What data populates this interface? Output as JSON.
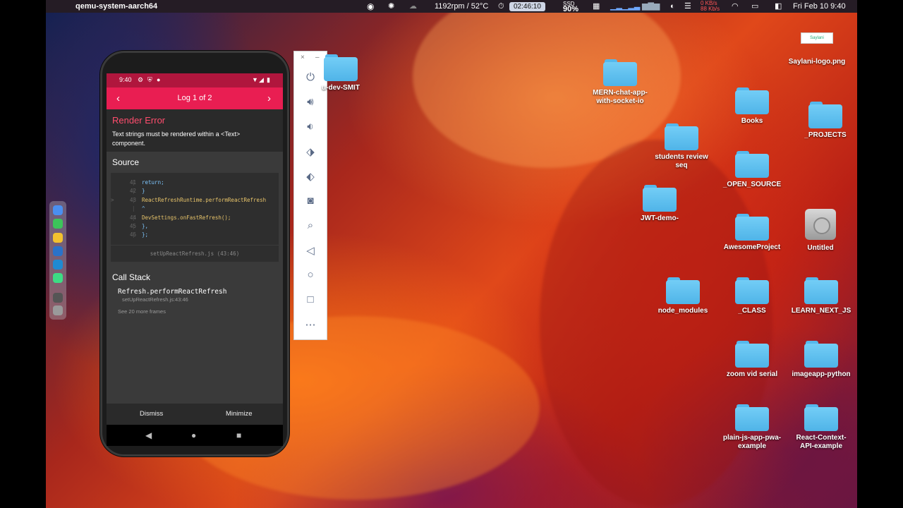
{
  "menubar": {
    "app_name": "qemu-system-aarch64",
    "fan_temp": "1192rpm / 52°C",
    "timer": "02:46:10",
    "ssd_label": "SSD",
    "ssd_value": "90%",
    "net_speed_up": "0 KB/s",
    "net_speed_down": "88 Kb/s",
    "datetime": "Fri Feb 10  9:40"
  },
  "phone": {
    "status_time": "9:40",
    "log_title": "Log 1 of 2",
    "error_title": "Render Error",
    "error_message": "Text strings must be rendered within a <Text> component.",
    "source_heading": "Source",
    "code_lines": [
      {
        "num": "41",
        "marker": "",
        "code": "    return;"
      },
      {
        "num": "42",
        "marker": "",
        "code": "  }"
      },
      {
        "num": "43",
        "marker": ">",
        "code": "  ReactRefreshRuntime.performReactRefresh"
      },
      {
        "num": "",
        "marker": "",
        "code": "  ^"
      },
      {
        "num": "44",
        "marker": "",
        "code": "  DevSettings.onFastRefresh();"
      },
      {
        "num": "45",
        "marker": "",
        "code": " },"
      },
      {
        "num": "46",
        "marker": "",
        "code": "};"
      }
    ],
    "code_footer": "setUpReactRefresh.js (43:46)",
    "callstack_heading": "Call Stack",
    "stack_frame_name": "Refresh.performReactRefresh",
    "stack_frame_file": "setUpReactRefresh.js:43:46",
    "more_frames": "See 20 more frames",
    "dismiss_label": "Dismiss",
    "minimize_label": "Minimize"
  },
  "emulator_toolbar": {
    "close_label": "×",
    "minimize_label": "–",
    "icons": [
      "power-icon",
      "volume-up-icon",
      "volume-down-icon",
      "rotate-left-icon",
      "rotate-right-icon",
      "camera-icon",
      "zoom-icon",
      "back-icon",
      "home-icon",
      "overview-icon",
      "more-icon"
    ]
  },
  "desktop": {
    "items": [
      {
        "label": "Saylani-logo.png",
        "type": "image"
      },
      {
        "label": "MERN-chat-app-with-socket-io",
        "type": "folder"
      },
      {
        "label": "Books",
        "type": "folder"
      },
      {
        "label": "_PROJECTS",
        "type": "folder"
      },
      {
        "label": "students review seq",
        "type": "folder"
      },
      {
        "label": "_OPEN_SOURCE",
        "type": "folder"
      },
      {
        "label": "JWT-demo-",
        "type": "folder"
      },
      {
        "label": "AwesomeProject",
        "type": "folder"
      },
      {
        "label": "Untitled",
        "type": "drive"
      },
      {
        "label": "node_modules",
        "type": "folder"
      },
      {
        "label": "_CLASS",
        "type": "folder"
      },
      {
        "label": "LEARN_NEXT_JS",
        "type": "folder"
      },
      {
        "label": "zoom vid serial",
        "type": "folder"
      },
      {
        "label": "imageapp-python",
        "type": "folder"
      },
      {
        "label": "plain-js-app-pwa-example",
        "type": "folder"
      },
      {
        "label": "React-Context-API-example",
        "type": "folder"
      },
      {
        "label": "u-dev-SMIT",
        "type": "folder"
      }
    ]
  },
  "colors": {
    "accent": "#e91e52",
    "status_bar": "#b0163d",
    "error_title": "#ff4d6d",
    "folder": "#5ec0f0"
  }
}
